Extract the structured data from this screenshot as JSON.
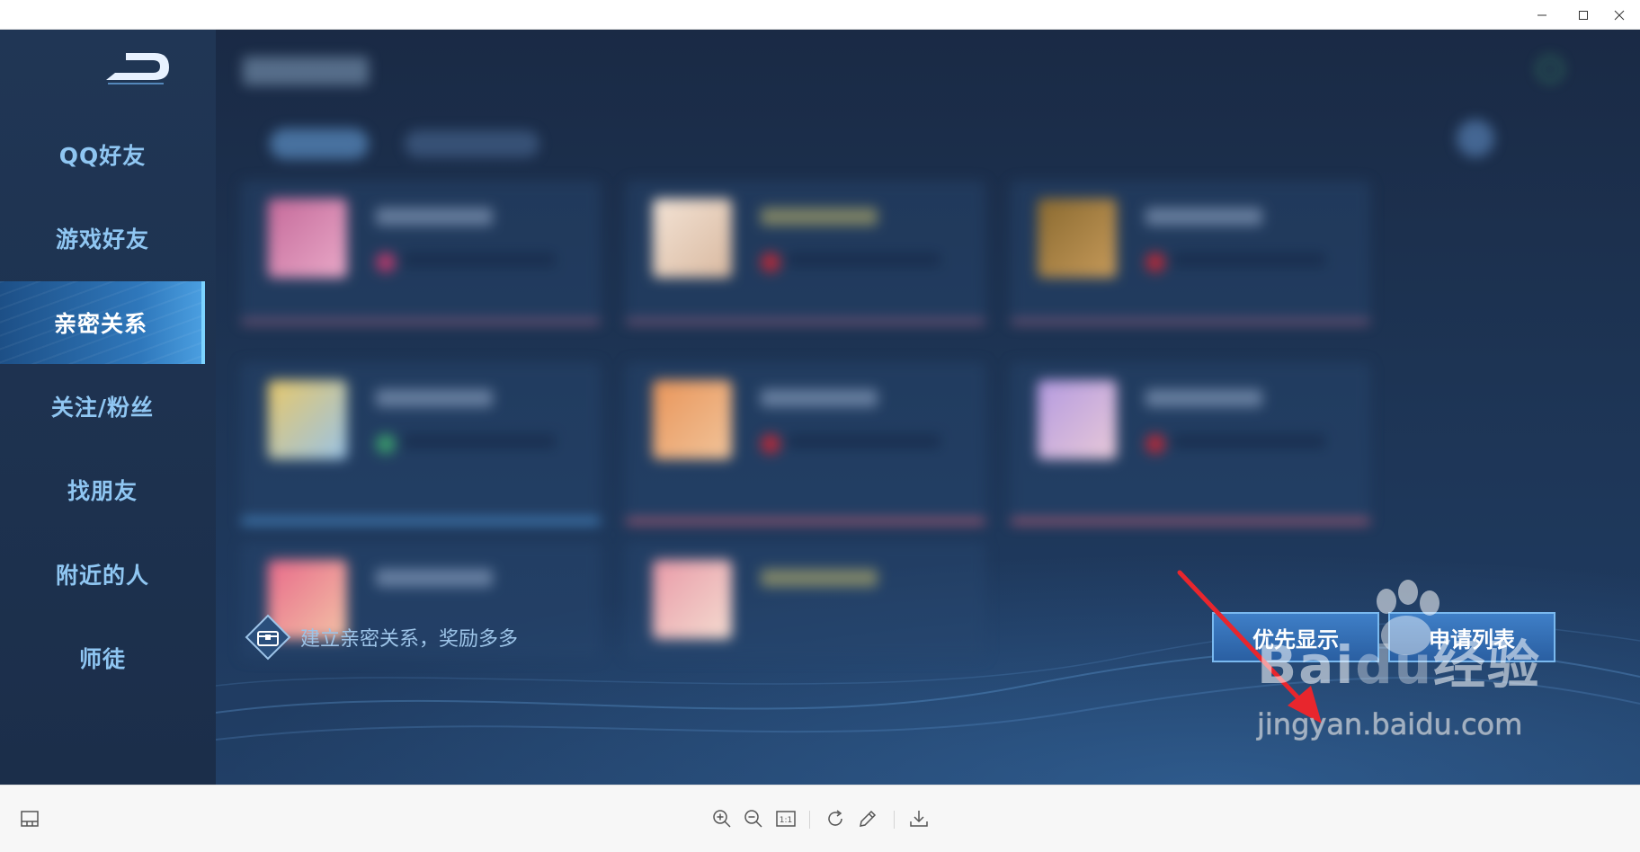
{
  "window": {
    "controls": [
      "minimize",
      "maximize",
      "close"
    ]
  },
  "sidebar": {
    "items": [
      {
        "label": "QQ好友",
        "active": false
      },
      {
        "label": "游戏好友",
        "active": false
      },
      {
        "label": "亲密关系",
        "active": true
      },
      {
        "label": "关注/粉丝",
        "active": false
      },
      {
        "label": "找朋友",
        "active": false
      },
      {
        "label": "附近的人",
        "active": false
      },
      {
        "label": "师徒",
        "active": false
      }
    ]
  },
  "footer": {
    "hint_text": "建立亲密关系，奖励多多",
    "priority_button": "优先显示",
    "request_button": "申请列表"
  },
  "watermark": {
    "main_prefix": "Bai",
    "main_du": "du",
    "main_suffix": "经验",
    "sub": "jingyan.baidu.com"
  },
  "toolbar": {
    "icons": [
      "layout-icon",
      "zoom-in-icon",
      "zoom-out-icon",
      "actual-size-icon",
      "rotate-icon",
      "edit-icon",
      "download-icon"
    ],
    "actual_size_label": "1:1"
  },
  "colors": {
    "accent": "#3f7fc7",
    "annotation_arrow": "#e8262d",
    "sidebar_text": "#8fc6f2"
  }
}
